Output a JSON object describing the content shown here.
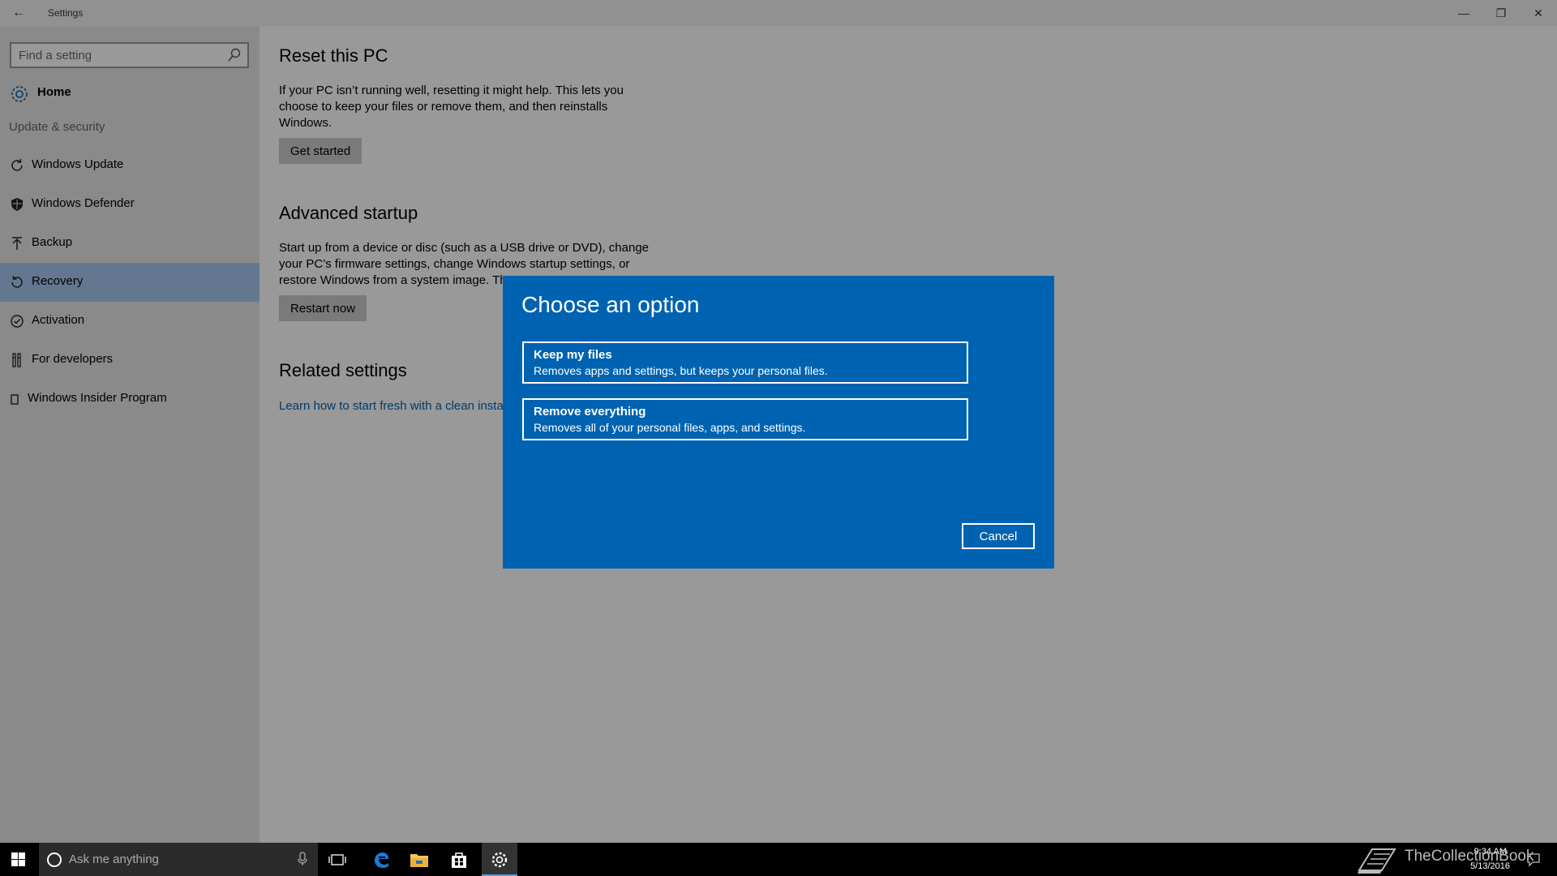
{
  "window": {
    "title": "Settings",
    "back_glyph": "←",
    "minimize_glyph": "—",
    "restore_glyph": "❐",
    "close_glyph": "✕"
  },
  "sidebar": {
    "search_placeholder": "Find a setting",
    "home_label": "Home",
    "section_label": "Update & security",
    "items": [
      {
        "label": "Windows Update",
        "icon": "refresh-icon"
      },
      {
        "label": "Windows Defender",
        "icon": "shield-icon"
      },
      {
        "label": "Backup",
        "icon": "upload-arrow-icon"
      },
      {
        "label": "Recovery",
        "icon": "history-icon",
        "selected": true
      },
      {
        "label": "Activation",
        "icon": "check-circle-icon"
      },
      {
        "label": "For developers",
        "icon": "tools-icon"
      },
      {
        "label": "Windows Insider Program",
        "icon": "device-icon"
      }
    ]
  },
  "content": {
    "reset": {
      "title": "Reset this PC",
      "description": "If your PC isn’t running well, resetting it might help. This lets you choose to keep your files or remove them, and then reinstalls Windows.",
      "button": "Get started"
    },
    "advanced": {
      "title": "Advanced startup",
      "description": "Start up from a device or disc (such as a USB drive or DVD), change your PC’s firmware settings, change Windows startup settings, or restore Windows from a system image. Th",
      "button": "Restart now"
    },
    "related": {
      "title": "Related settings",
      "link": "Learn how to start fresh with a clean insta"
    }
  },
  "dialog": {
    "title": "Choose an option",
    "options": [
      {
        "title": "Keep my files",
        "subtitle": "Removes apps and settings, but keeps your personal files."
      },
      {
        "title": "Remove everything",
        "subtitle": "Removes all of your personal files, apps, and settings."
      }
    ],
    "cancel": "Cancel"
  },
  "taskbar": {
    "search_placeholder": "Ask me anything",
    "clock_time": "9:34 AM",
    "clock_date": "5/13/2016",
    "watermark": "TheCollectionBook"
  },
  "colors": {
    "accent": "#0063b1",
    "selected_nav": "#a6c8f0",
    "link": "#0063b1"
  }
}
